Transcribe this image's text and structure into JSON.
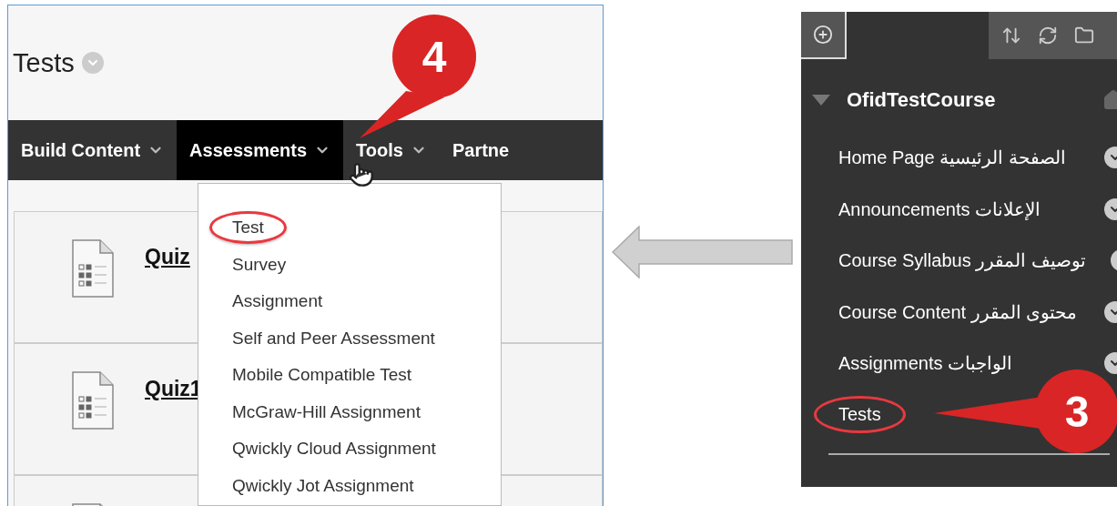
{
  "course_page": {
    "page_title": "Tests",
    "nav_tabs": [
      {
        "label": "Build Content",
        "selected": false
      },
      {
        "label": "Assessments",
        "selected": true
      },
      {
        "label": "Tools",
        "selected": false
      },
      {
        "label": "Partne",
        "selected": false
      }
    ],
    "content_items": [
      {
        "title": "Quiz"
      },
      {
        "title": "Quiz1"
      }
    ],
    "dropdown_menu": [
      {
        "label": "Test",
        "circled": true
      },
      {
        "label": "Survey",
        "circled": false
      },
      {
        "label": "Assignment",
        "circled": false
      },
      {
        "label": "Self and Peer Assessment",
        "circled": false
      },
      {
        "label": "Mobile Compatible Test",
        "circled": false
      },
      {
        "label": "McGraw-Hill Assignment",
        "circled": false
      },
      {
        "label": "Qwickly Cloud Assignment",
        "circled": false
      },
      {
        "label": "Qwickly Jot Assignment",
        "circled": false
      }
    ]
  },
  "course_menu": {
    "course_title": "OfidTestCourse",
    "items": [
      {
        "label": "Home Page الصفحة الرئيسية",
        "circled": false
      },
      {
        "label": "Announcements الإعلانات",
        "circled": false
      },
      {
        "label": "Course Syllabus توصيف المقرر",
        "circled": false
      },
      {
        "label": "Course Content محتوى المقرر",
        "circled": false
      },
      {
        "label": "Assignments الواجبات",
        "circled": false
      },
      {
        "label": "Tests",
        "circled": true
      }
    ]
  },
  "callouts": [
    {
      "number": "4"
    },
    {
      "number": "3"
    }
  ]
}
